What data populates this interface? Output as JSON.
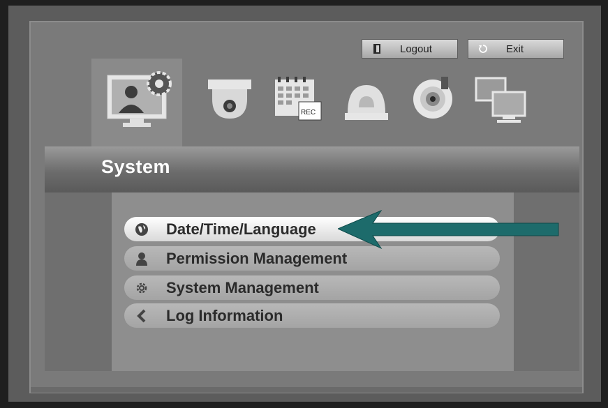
{
  "header": {
    "logout_label": "Logout",
    "exit_label": "Exit"
  },
  "icons": [
    {
      "name": "monitor-gear-icon"
    },
    {
      "name": "dome-camera-icon"
    },
    {
      "name": "calendar-rec-icon",
      "badge": "REC"
    },
    {
      "name": "alarm-dome-icon"
    },
    {
      "name": "ptz-lens-icon"
    },
    {
      "name": "network-monitors-icon"
    }
  ],
  "section": {
    "title": "System"
  },
  "menu": {
    "items": [
      {
        "label": "Date/Time/Language",
        "icon": "globe-icon",
        "selected": true
      },
      {
        "label": "Permission Management",
        "icon": "user-icon",
        "selected": false
      },
      {
        "label": "System Management",
        "icon": "gear-icon",
        "selected": false
      },
      {
        "label": "Log Information",
        "icon": "chevron-icon",
        "selected": false
      }
    ]
  },
  "colors": {
    "arrow": "#1d6b6b",
    "active_item": "#f2f2f2",
    "section_text": "#ffffff"
  }
}
